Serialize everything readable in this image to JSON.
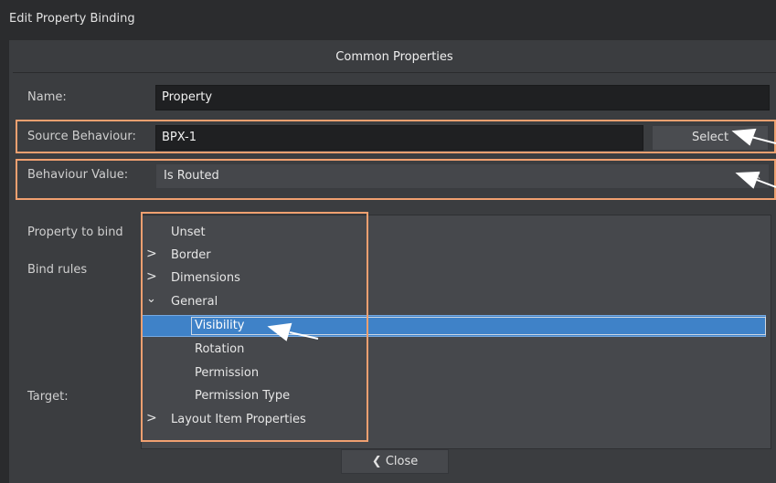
{
  "window": {
    "title": "Edit Property Binding"
  },
  "section": {
    "title": "Common Properties"
  },
  "name_row": {
    "label": "Name:",
    "value": "Property"
  },
  "source_row": {
    "label": "Source Behaviour:",
    "value": "BPX-1",
    "button": "Select"
  },
  "behaviour_row": {
    "label": "Behaviour Value:",
    "value": "Is Routed"
  },
  "property_label": "Property to bind",
  "bind_rules_label": "Bind rules",
  "target_label": "Target:",
  "tree": {
    "items": [
      {
        "label": "Unset"
      },
      {
        "label": "Border"
      },
      {
        "label": "Dimensions"
      },
      {
        "label": "General"
      },
      {
        "label": "Visibility"
      },
      {
        "label": "Rotation"
      },
      {
        "label": "Permission"
      },
      {
        "label": "Permission Type"
      },
      {
        "label": "Layout Item Properties"
      }
    ]
  },
  "close_button": {
    "label": "Close"
  },
  "colors": {
    "highlight": "#f0a070",
    "selection": "#3f82c8"
  }
}
